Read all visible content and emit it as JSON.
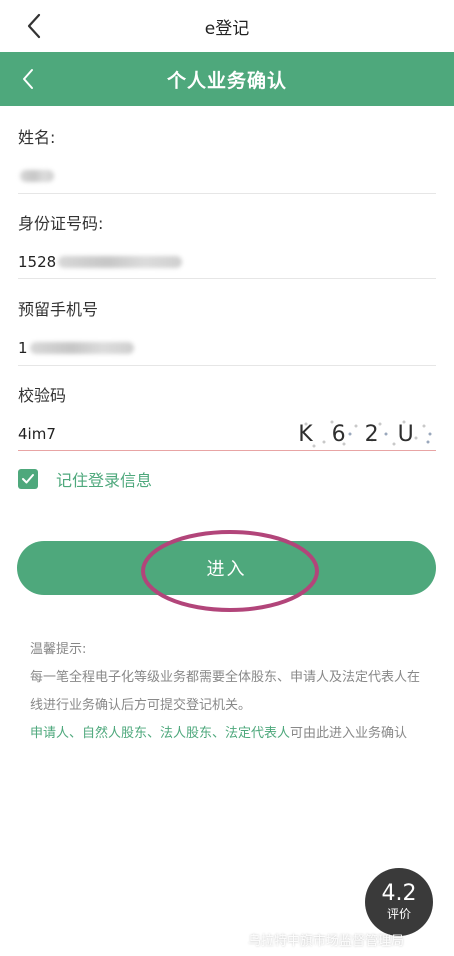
{
  "system_bar": {
    "title": "e登记"
  },
  "header": {
    "title": "个人业务确认"
  },
  "form": {
    "name": {
      "label": "姓名:"
    },
    "id_number": {
      "label": "身份证号码:",
      "value_prefix": "1528"
    },
    "phone": {
      "label": "预留手机号",
      "value_prefix": "1"
    },
    "captcha": {
      "label": "校验码",
      "value": "4im7",
      "image_text": "K 6 2 U"
    }
  },
  "remember": {
    "label": "记住登录信息",
    "checked": true
  },
  "enter_button": {
    "label": "进入"
  },
  "tips": {
    "title": "温馨提示:",
    "line1": "每一笔全程电子化等级业务都需要全体股东、申请人及法定代表人在线进行业务确认后方可提交登记机关。",
    "highlight": "申请人、自然人股东、法人股东、法定代表人",
    "line2_rest": "可由此进入业务确认"
  },
  "rating": {
    "score": "4.2",
    "label": "评价"
  },
  "watermark": {
    "text": "乌拉特中旗市场监督管理局"
  },
  "colors": {
    "accent": "#4ea87c",
    "annotation": "#b2457a"
  }
}
